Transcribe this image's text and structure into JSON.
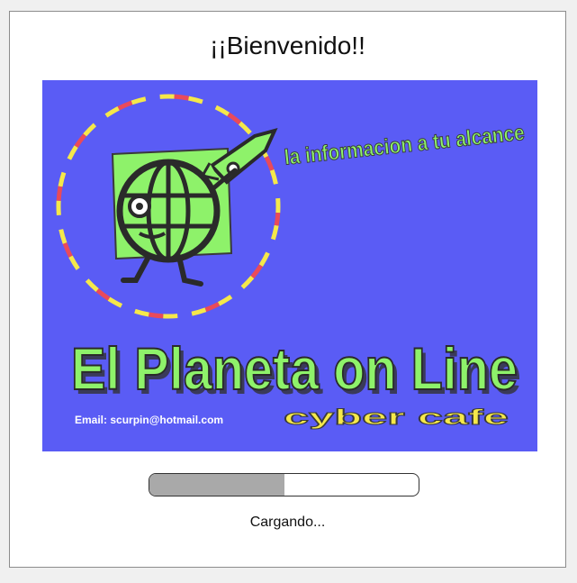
{
  "dialog": {
    "title": "¡¡Bienvenido!!",
    "status": "Cargando...",
    "progress_fraction": 0.5
  },
  "banner": {
    "tagline": "la informacion a tu alcance",
    "brand": "El Planeta on Line",
    "email": "Email: scurpin@hotmail.com",
    "subtitle": "cyber cafe",
    "colors": {
      "background": "#5a5cf5",
      "green": "#8ef26a",
      "yellow": "#f5e84a"
    },
    "logo_icon": "walking-globe-rocket-icon"
  }
}
